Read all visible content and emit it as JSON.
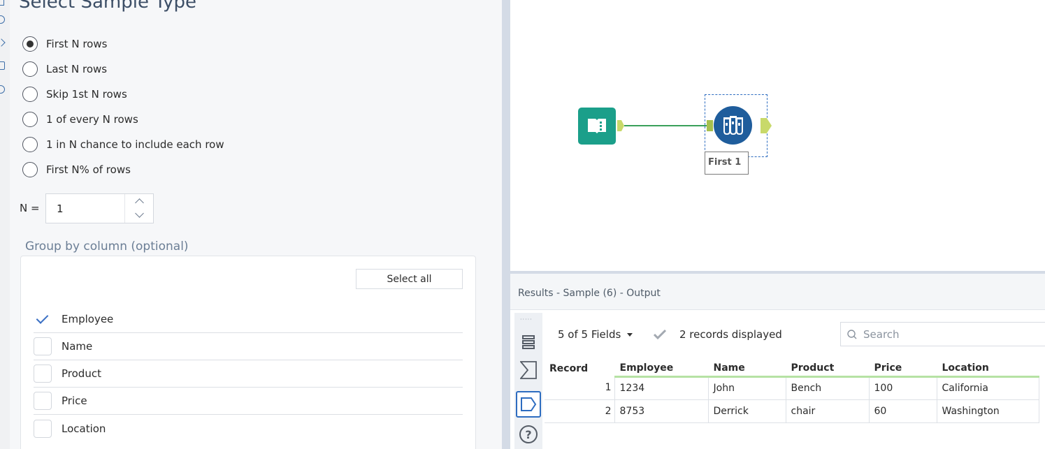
{
  "config": {
    "title": "Select Sample Type",
    "sample_options": [
      {
        "label": "First N rows",
        "selected": true
      },
      {
        "label": "Last N rows",
        "selected": false
      },
      {
        "label": "Skip 1st N rows",
        "selected": false
      },
      {
        "label": "1 of every N rows",
        "selected": false
      },
      {
        "label": "1 in N chance to include each row",
        "selected": false
      },
      {
        "label": "First N% of rows",
        "selected": false
      }
    ],
    "n_label": "N =",
    "n_value": "1",
    "group_by_label": "Group by column (optional)",
    "select_all_label": "Select all",
    "columns": [
      {
        "label": "Employee",
        "checked": true
      },
      {
        "label": "Name",
        "checked": false
      },
      {
        "label": "Product",
        "checked": false
      },
      {
        "label": "Price",
        "checked": false
      },
      {
        "label": "Location",
        "checked": false
      }
    ]
  },
  "canvas": {
    "input_tool_icon": "book-icon",
    "sample_tool_icon": "test-tubes-icon",
    "sample_tool_annotation": "First 1"
  },
  "results": {
    "header": "Results - Sample (6) - Output",
    "fields_selector": "5 of 5 Fields",
    "records_displayed": "2 records displayed",
    "search_placeholder": "Search",
    "columns": [
      "Record",
      "Employee",
      "Name",
      "Product",
      "Price",
      "Location"
    ],
    "rows": [
      [
        "1",
        "1234",
        "John",
        "Bench",
        "100",
        "California"
      ],
      [
        "2",
        "8753",
        "Derrick",
        "chair",
        "60",
        "Washington"
      ]
    ]
  },
  "colors": {
    "accent_blue": "#2d6cc0",
    "input_tool": "#1b9f8a",
    "sample_tool": "#1f5d9c",
    "connection": "#3aa05a",
    "header_underline": "#b6e2a4"
  }
}
